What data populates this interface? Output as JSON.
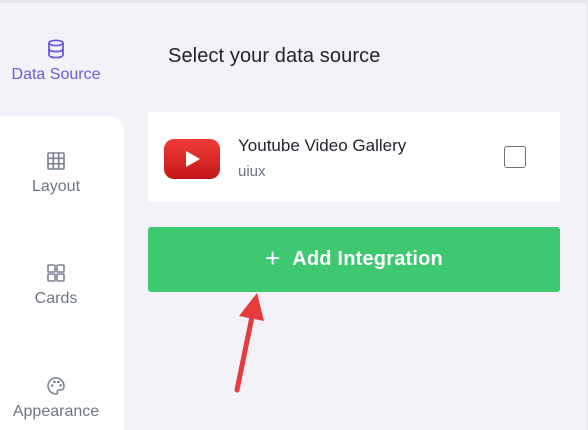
{
  "sidebar": {
    "items": [
      {
        "label": "Data Source",
        "icon": "database-icon",
        "active": true
      },
      {
        "label": "Layout",
        "icon": "grid-icon",
        "active": false
      },
      {
        "label": "Cards",
        "icon": "cards-icon",
        "active": false
      },
      {
        "label": "Appearance",
        "icon": "palette-icon",
        "active": false
      }
    ]
  },
  "main": {
    "title": "Select your data source",
    "sources": [
      {
        "name": "Youtube Video Gallery",
        "subtitle": "uiux",
        "icon": "youtube-logo-icon",
        "checked": false
      }
    ],
    "add_button": {
      "icon": "plus-icon",
      "label": "Add Integration"
    }
  },
  "colors": {
    "accent": "#6b5bd6",
    "button": "#3ec872",
    "annotation_arrow": "#e53d3d",
    "youtube_red": "#e52d27"
  }
}
